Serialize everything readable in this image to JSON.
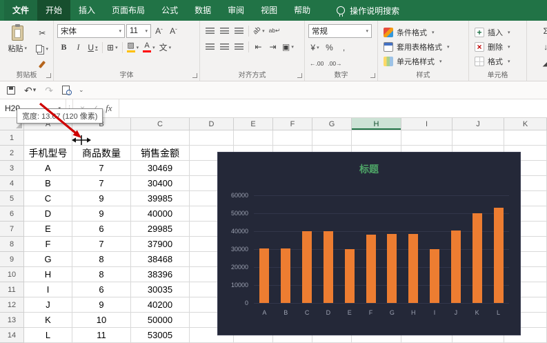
{
  "app": {
    "tabs": [
      {
        "label": "文件",
        "active": false
      },
      {
        "label": "开始",
        "active": true
      },
      {
        "label": "插入",
        "active": false
      },
      {
        "label": "页面布局",
        "active": false
      },
      {
        "label": "公式",
        "active": false
      },
      {
        "label": "数据",
        "active": false
      },
      {
        "label": "审阅",
        "active": false
      },
      {
        "label": "视图",
        "active": false
      },
      {
        "label": "帮助",
        "active": false
      }
    ],
    "search_label": "操作说明搜索"
  },
  "ribbon": {
    "clipboard": {
      "label": "剪贴板",
      "paste": "粘贴"
    },
    "font": {
      "label": "字体",
      "font_name": "宋体",
      "font_size": "11"
    },
    "alignment": {
      "label": "对齐方式"
    },
    "number": {
      "label": "数字",
      "format": "常规"
    },
    "styles": {
      "label": "样式",
      "items": [
        "条件格式",
        "套用表格格式",
        "单元格样式"
      ]
    },
    "cells": {
      "label": "单元格",
      "items": [
        "插入",
        "删除",
        "格式"
      ]
    },
    "editing": {
      "sigma": "Σ"
    }
  },
  "formula_bar": {
    "name_box": "H20",
    "fx": "fx"
  },
  "tooltip": {
    "text": "宽度: 13.67 (120 像素)"
  },
  "sheet": {
    "columns": [
      "A",
      "B",
      "C",
      "D",
      "E",
      "F",
      "G",
      "H",
      "I",
      "J",
      "K"
    ],
    "selected_column": "H",
    "visible_rows": 14,
    "table": {
      "header_row": 2,
      "headers": [
        "手机型号",
        "商品数量",
        "销售金额"
      ],
      "rows": [
        [
          "A",
          "7",
          "30469"
        ],
        [
          "B",
          "7",
          "30400"
        ],
        [
          "C",
          "9",
          "39985"
        ],
        [
          "D",
          "9",
          "40000"
        ],
        [
          "E",
          "6",
          "29985"
        ],
        [
          "F",
          "7",
          "37900"
        ],
        [
          "G",
          "8",
          "38468"
        ],
        [
          "H",
          "8",
          "38396"
        ],
        [
          "I",
          "6",
          "30035"
        ],
        [
          "J",
          "9",
          "40200"
        ],
        [
          "K",
          "10",
          "50000"
        ],
        [
          "L",
          "11",
          "53005"
        ]
      ]
    }
  },
  "chart_data": {
    "type": "bar",
    "title": "标题",
    "categories": [
      "A",
      "B",
      "C",
      "D",
      "E",
      "F",
      "G",
      "H",
      "I",
      "J",
      "K",
      "L"
    ],
    "values": [
      30469,
      30400,
      39985,
      40000,
      29985,
      37900,
      38468,
      38396,
      30035,
      40200,
      50000,
      53005
    ],
    "xlabel": "",
    "ylabel": "",
    "ylim": [
      0,
      60000
    ],
    "yticks": [
      0,
      10000,
      20000,
      30000,
      40000,
      50000,
      60000
    ],
    "grid": true,
    "legend": "none",
    "colors": {
      "bar": "#ED7D31",
      "background": "#242838",
      "title": "#4EA567",
      "axis_text": "#9BA0B0",
      "gridline": "#32364A"
    }
  }
}
